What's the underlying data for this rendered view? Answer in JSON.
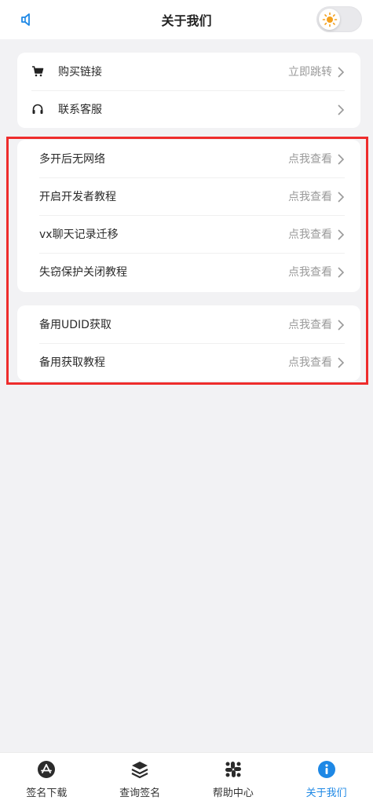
{
  "header": {
    "title": "关于我们",
    "speaker_icon": "speaker-icon",
    "theme_toggle_icon": "sun-icon"
  },
  "card_top": [
    {
      "icon": "cart-icon",
      "label": "购买链接",
      "value": "立即跳转"
    },
    {
      "icon": "headset-icon",
      "label": "联系客服",
      "value": ""
    }
  ],
  "card_tutorials": [
    {
      "label": "多开后无网络",
      "value": "点我查看"
    },
    {
      "label": "开启开发者教程",
      "value": "点我查看"
    },
    {
      "label": "vx聊天记录迁移",
      "value": "点我查看"
    },
    {
      "label": "失窃保护关闭教程",
      "value": "点我查看"
    }
  ],
  "card_udid": [
    {
      "label": "备用UDID获取",
      "value": "点我查看"
    },
    {
      "label": "备用获取教程",
      "value": "点我查看"
    }
  ],
  "tabbar": [
    {
      "label": "签名下载",
      "icon": "app-store-icon",
      "active": false
    },
    {
      "label": "查询签名",
      "icon": "layers-icon",
      "active": false
    },
    {
      "label": "帮助中心",
      "icon": "grid-icon",
      "active": false
    },
    {
      "label": "关于我们",
      "icon": "info-icon",
      "active": true
    }
  ],
  "colors": {
    "accent": "#1e88e5",
    "highlight_border": "#ee2c2c",
    "sun": "#f4a01c",
    "background": "#f2f2f4"
  }
}
